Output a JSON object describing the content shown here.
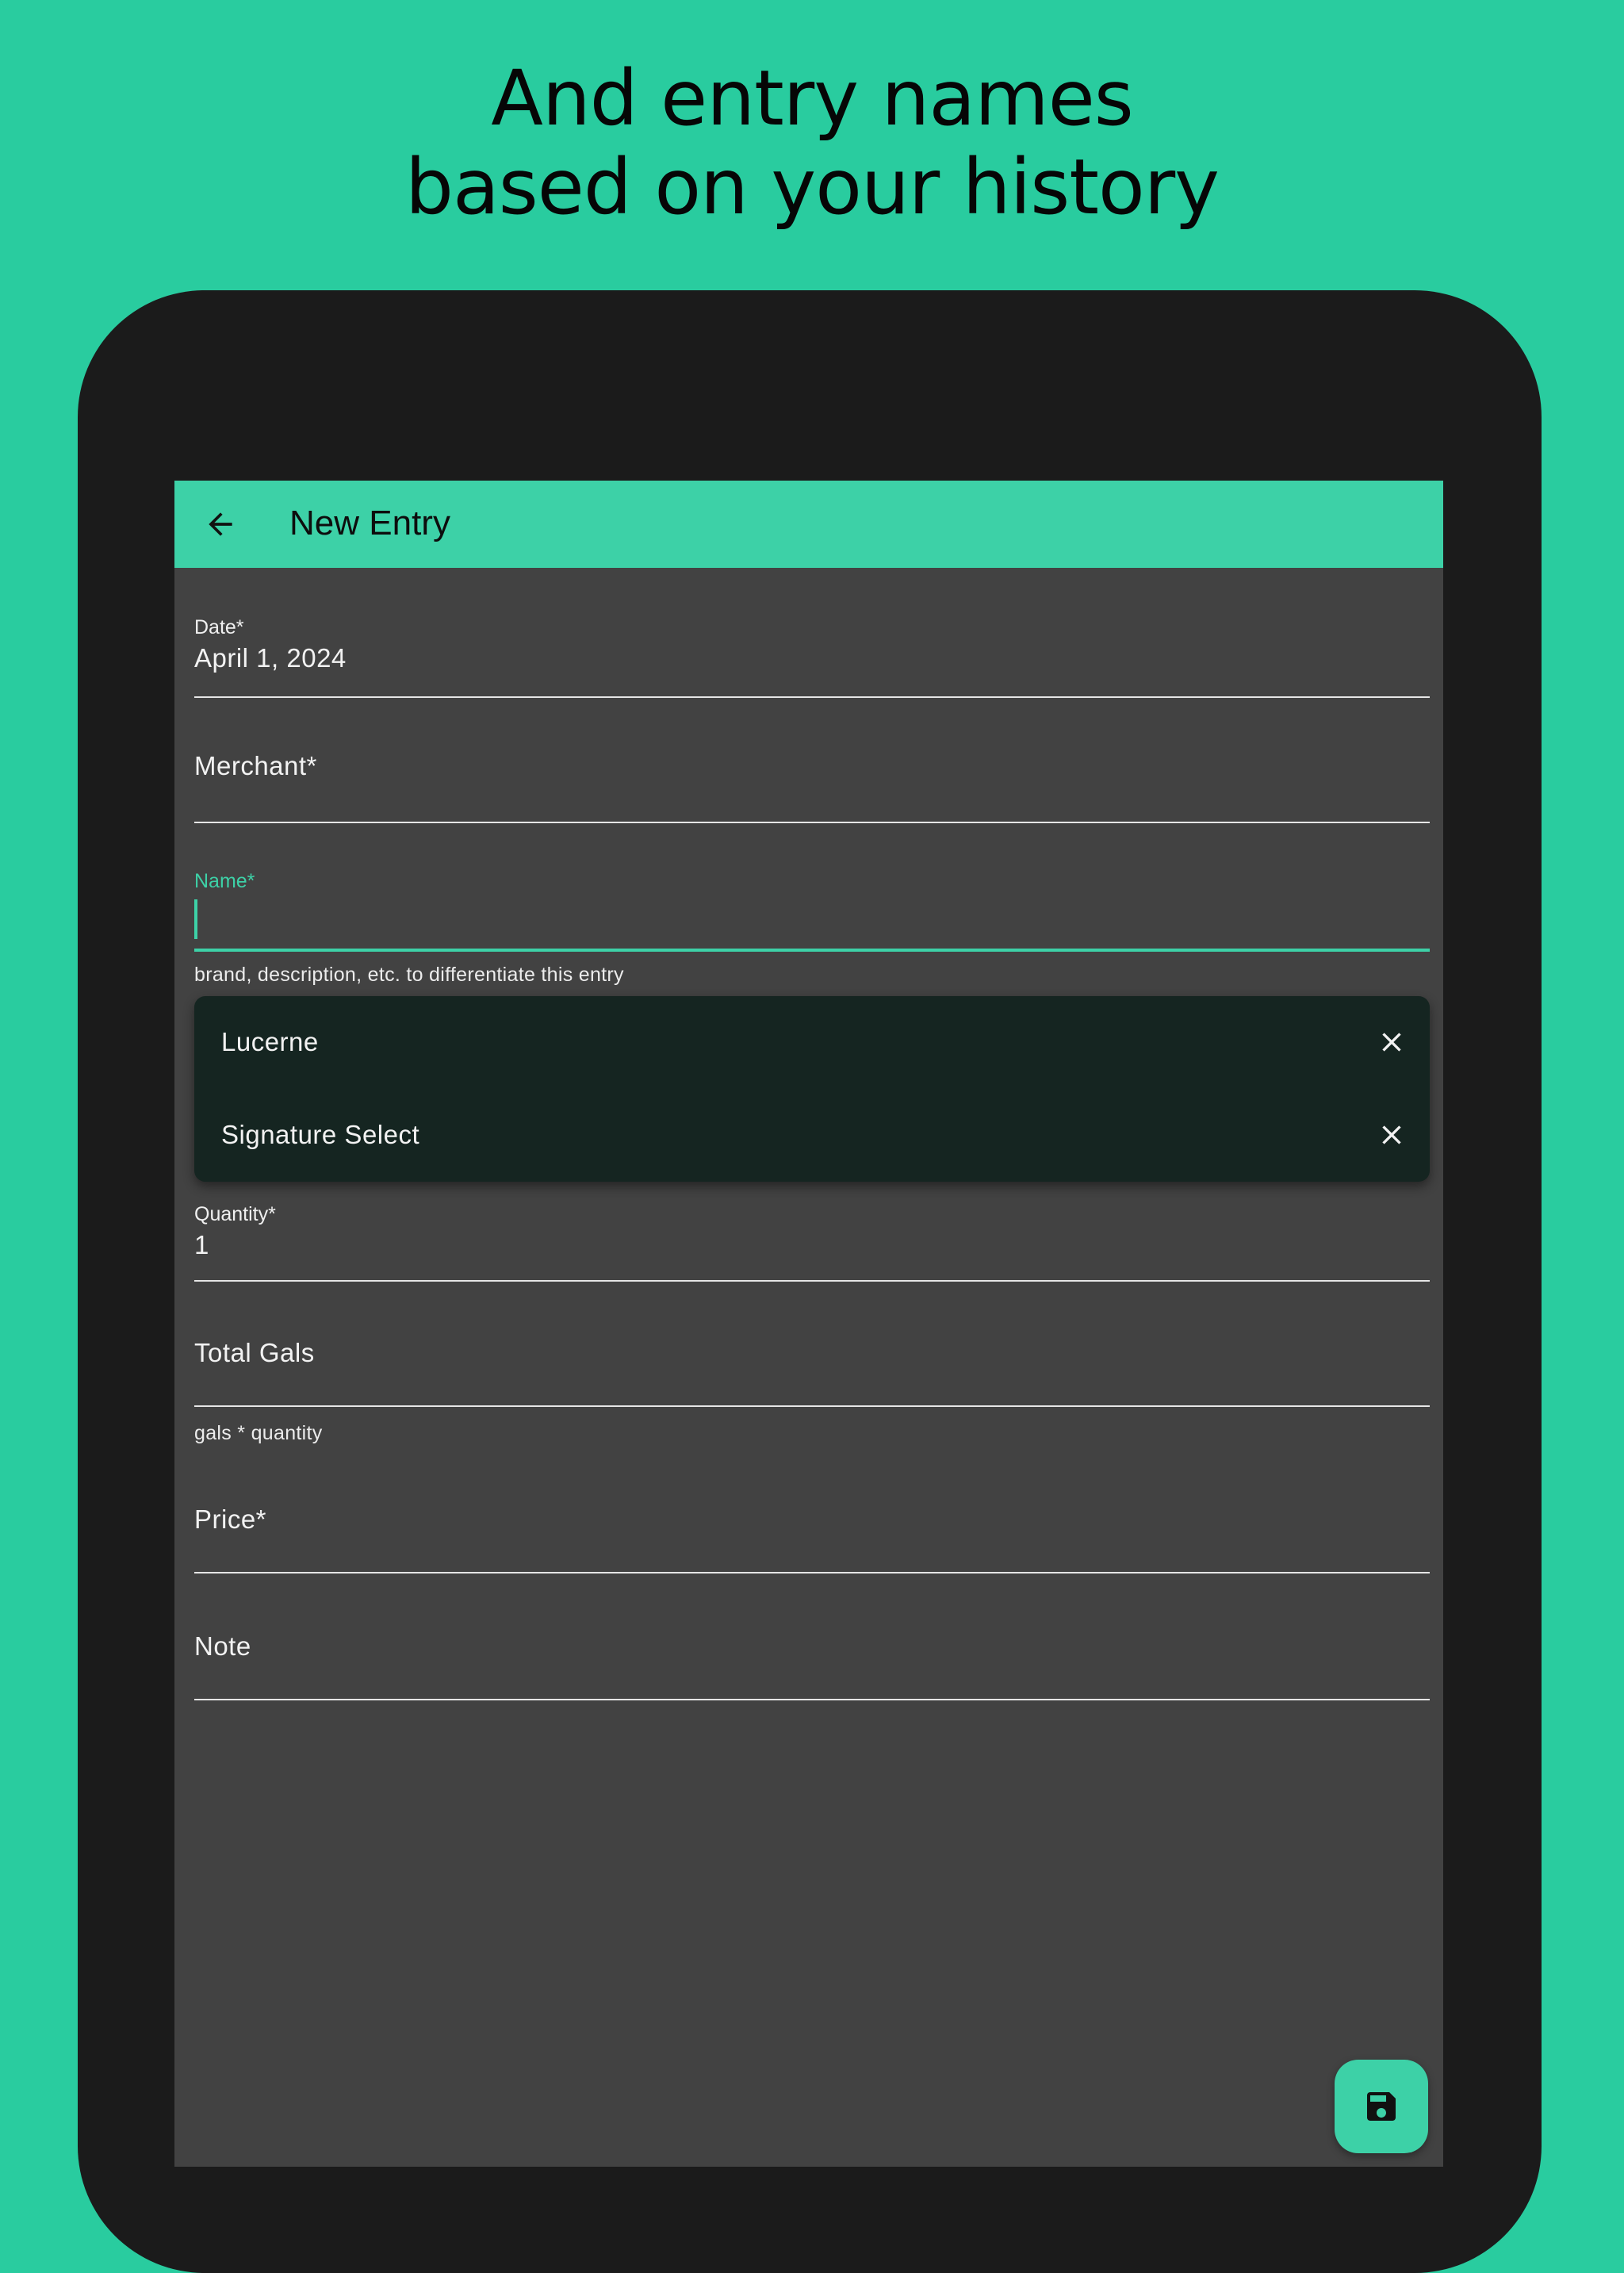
{
  "headline": {
    "line1": "And entry names",
    "line2": "based on your history"
  },
  "appbar": {
    "title": "New Entry",
    "back_icon": "arrow-back-icon"
  },
  "form": {
    "date": {
      "label": "Date*",
      "value": "April 1, 2024"
    },
    "merchant": {
      "label": "Merchant*"
    },
    "name": {
      "label": "Name*",
      "value": "",
      "helper": "brand, description, etc. to differentiate this entry"
    },
    "suggestions": [
      {
        "label": "Lucerne",
        "remove_icon": "close-icon"
      },
      {
        "label": "Signature Select",
        "remove_icon": "close-icon"
      }
    ],
    "quantity": {
      "label": "Quantity*",
      "value": "1"
    },
    "total_gals": {
      "label": "Total Gals",
      "helper": "gals * quantity"
    },
    "price": {
      "label": "Price*"
    },
    "note": {
      "label": "Note"
    }
  },
  "fab": {
    "icon": "save-icon"
  },
  "colors": {
    "background": "#29cc9f",
    "accent": "#3dd1a7",
    "surface": "#424242",
    "device": "#1b1b1b",
    "dropdown": "#152521"
  }
}
